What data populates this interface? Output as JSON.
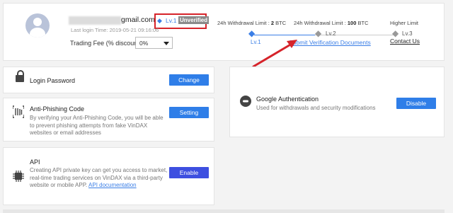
{
  "profile": {
    "email_suffix": "gmail.com",
    "level_label": "Lv.1",
    "verification_badge": "Unverified",
    "last_login": "Last login Time: 2019-05-21 09:16:06",
    "fee_label": "Trading Fee (% discount):",
    "fee_value": "0%"
  },
  "levels": {
    "limit1_prefix": "24h Withdrawal Limit :",
    "limit1_value": "2",
    "limit1_unit": "BTC",
    "limit2_prefix": "24h Withdrawal Limit :",
    "limit2_value": "100",
    "limit2_unit": "BTC",
    "limit3": "Higher Limit",
    "lv1": "Lv.1",
    "lv2": "Lv.2",
    "lv3": "Lv.3",
    "submit_link": "Submit Verification Documents",
    "contact_link": "Contact Us"
  },
  "cards": {
    "login": {
      "title": "Login Password",
      "button": "Change"
    },
    "phishing": {
      "title": "Anti-Phishing Code",
      "desc": "By verifying your Anti-Phishing Code, you will be able to prevent phishing attempts from fake VinDAX websites or email addresses",
      "button": "Setting"
    },
    "api": {
      "title": "API",
      "desc": "Creating API private key can get you access to market, real-time trading services on VinDAX via a third-party website or mobile APP.",
      "link": "API documentation",
      "button": "Enable"
    },
    "google": {
      "title": "Google Authentication",
      "desc": "Used for withdrawals and security modifications",
      "button": "Disable"
    }
  },
  "colors": {
    "accent": "#2f7ee8",
    "annotation_red": "#d6232a",
    "badge_gray": "#8a8a8a"
  },
  "icons": [
    "user-avatar-icon",
    "diamond-icon",
    "lock-icon",
    "fingerprint-icon",
    "chip-icon",
    "toggle-icon",
    "arrow-annotation"
  ]
}
